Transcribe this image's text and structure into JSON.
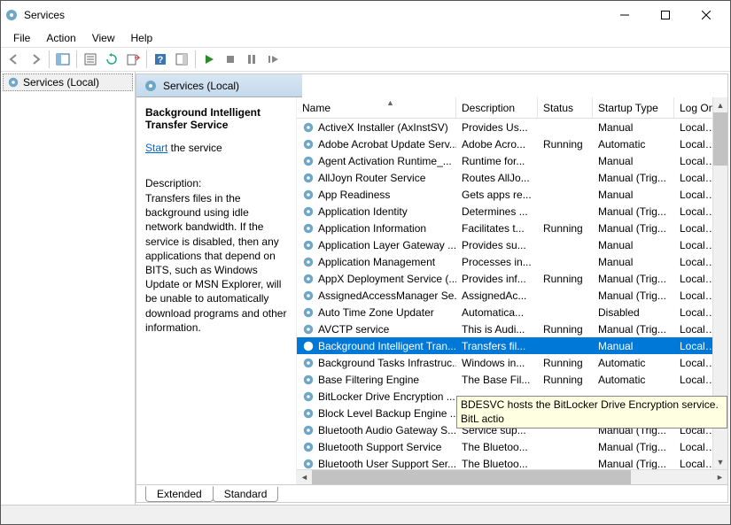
{
  "window": {
    "title": "Services"
  },
  "menus": [
    "File",
    "Action",
    "View",
    "Help"
  ],
  "tree": {
    "root": "Services (Local)"
  },
  "pane": {
    "header": "Services (Local)"
  },
  "detail": {
    "name": "Background Intelligent Transfer Service",
    "start_label": "Start",
    "start_suffix": " the service",
    "desc_label": "Description:",
    "desc": "Transfers files in the background using idle network bandwidth. If the service is disabled, then any applications that depend on BITS, such as Windows Update or MSN Explorer, will be unable to automatically download programs and other information."
  },
  "columns": {
    "name": "Name",
    "desc": "Description",
    "status": "Status",
    "startup": "Startup Type",
    "logon": "Log On"
  },
  "tooltip": "BDESVC hosts the BitLocker Drive Encryption service. BitL actio",
  "tabs": {
    "extended": "Extended",
    "standard": "Standard"
  },
  "services": [
    {
      "name": "ActiveX Installer (AxInstSV)",
      "desc": "Provides Us...",
      "status": "",
      "startup": "Manual",
      "logon": "Local Sy"
    },
    {
      "name": "Adobe Acrobat Update Serv...",
      "desc": "Adobe Acro...",
      "status": "Running",
      "startup": "Automatic",
      "logon": "Local Sy"
    },
    {
      "name": "Agent Activation Runtime_...",
      "desc": "Runtime for...",
      "status": "",
      "startup": "Manual",
      "logon": "Local Sy"
    },
    {
      "name": "AllJoyn Router Service",
      "desc": "Routes AllJo...",
      "status": "",
      "startup": "Manual (Trig...",
      "logon": "Local Se"
    },
    {
      "name": "App Readiness",
      "desc": "Gets apps re...",
      "status": "",
      "startup": "Manual",
      "logon": "Local Sy"
    },
    {
      "name": "Application Identity",
      "desc": "Determines ...",
      "status": "",
      "startup": "Manual (Trig...",
      "logon": "Local Se"
    },
    {
      "name": "Application Information",
      "desc": "Facilitates t...",
      "status": "Running",
      "startup": "Manual (Trig...",
      "logon": "Local Sy"
    },
    {
      "name": "Application Layer Gateway ...",
      "desc": "Provides su...",
      "status": "",
      "startup": "Manual",
      "logon": "Local Se"
    },
    {
      "name": "Application Management",
      "desc": "Processes in...",
      "status": "",
      "startup": "Manual",
      "logon": "Local Sy"
    },
    {
      "name": "AppX Deployment Service (...",
      "desc": "Provides inf...",
      "status": "Running",
      "startup": "Manual (Trig...",
      "logon": "Local Sy"
    },
    {
      "name": "AssignedAccessManager Se...",
      "desc": "AssignedAc...",
      "status": "",
      "startup": "Manual (Trig...",
      "logon": "Local Sy"
    },
    {
      "name": "Auto Time Zone Updater",
      "desc": "Automatica...",
      "status": "",
      "startup": "Disabled",
      "logon": "Local Se"
    },
    {
      "name": "AVCTP service",
      "desc": "This is Audi...",
      "status": "Running",
      "startup": "Manual (Trig...",
      "logon": "Local Se"
    },
    {
      "name": "Background Intelligent Tran...",
      "desc": "Transfers fil...",
      "status": "",
      "startup": "Manual",
      "logon": "Local Sy",
      "selected": true
    },
    {
      "name": "Background Tasks Infrastruc...",
      "desc": "Windows in...",
      "status": "Running",
      "startup": "Automatic",
      "logon": "Local Sy"
    },
    {
      "name": "Base Filtering Engine",
      "desc": "The Base Fil...",
      "status": "Running",
      "startup": "Automatic",
      "logon": "Local Se"
    },
    {
      "name": "BitLocker Drive Encryption ...",
      "desc": "",
      "status": "",
      "startup": "",
      "logon": ""
    },
    {
      "name": "Block Level Backup Engine ...",
      "desc": "",
      "status": "",
      "startup": "",
      "logon": ""
    },
    {
      "name": "Bluetooth Audio Gateway S...",
      "desc": "Service sup...",
      "status": "",
      "startup": "Manual (Trig...",
      "logon": "Local Se"
    },
    {
      "name": "Bluetooth Support Service",
      "desc": "The Bluetoo...",
      "status": "",
      "startup": "Manual (Trig...",
      "logon": "Local Se"
    },
    {
      "name": "Bluetooth User Support Ser...",
      "desc": "The Bluetoo...",
      "status": "",
      "startup": "Manual (Trig...",
      "logon": "Local Sy"
    }
  ]
}
